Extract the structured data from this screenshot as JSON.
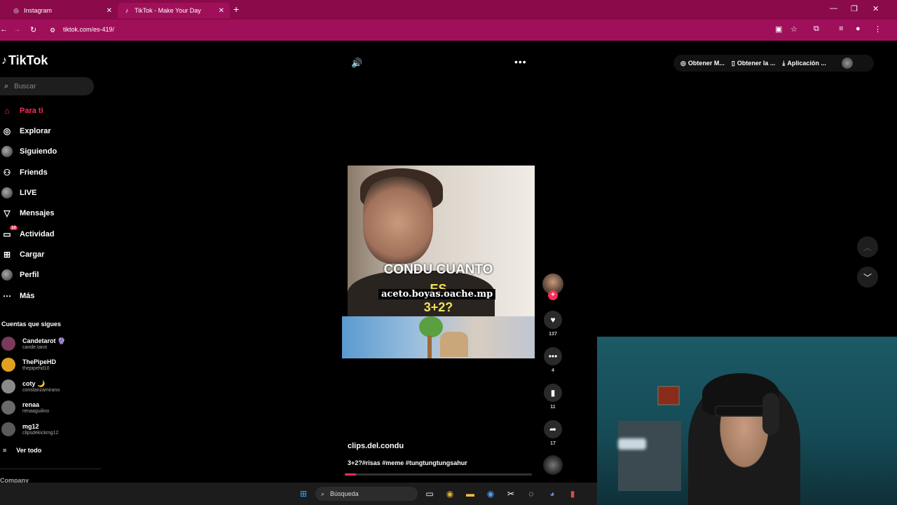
{
  "browser": {
    "tabs": [
      {
        "label": "Instagram",
        "icon": "instagram-icon"
      },
      {
        "label": "TikTok - Make Your Day",
        "icon": "tiktok-icon"
      }
    ],
    "url": "tiktok.com/es-419/"
  },
  "tiktok": {
    "logo_text": "TikTok",
    "search_placeholder": "Buscar",
    "nav": [
      {
        "label": "Para ti",
        "icon": "home-icon",
        "active": true
      },
      {
        "label": "Explorar",
        "icon": "compass-icon"
      },
      {
        "label": "Siguiendo",
        "icon": "following-icon"
      },
      {
        "label": "Friends",
        "icon": "friends-icon"
      },
      {
        "label": "LIVE",
        "icon": "live-icon"
      },
      {
        "label": "Mensajes",
        "icon": "messages-icon"
      },
      {
        "label": "Actividad",
        "icon": "activity-icon",
        "badge": "10"
      },
      {
        "label": "Cargar",
        "icon": "upload-icon"
      },
      {
        "label": "Perfil",
        "icon": "profile-icon"
      },
      {
        "label": "Más",
        "icon": "more-icon"
      }
    ],
    "following_header": "Cuentas que sigues",
    "following": [
      {
        "name": "Candetarot 🔮",
        "handle": "cande.tarot",
        "color": "#7a3a5a"
      },
      {
        "name": "ThePipeHD",
        "handle": "thepipehd10",
        "color": "#e0a020"
      },
      {
        "name": "coty 🌙",
        "handle": "constanzamirano",
        "color": "#8a8a8a"
      },
      {
        "name": "renaa",
        "handle": "renaaguilino",
        "color": "#6a6a6a"
      },
      {
        "name": "mg12",
        "handle": "clipsdekickmg12",
        "color": "#5a5a5a"
      }
    ],
    "see_all": "Ver todo",
    "company": "Company",
    "top_right": [
      {
        "label": "Obtener M...",
        "icon": "coin-icon"
      },
      {
        "label": "Obtener la ...",
        "icon": "phone-icon"
      },
      {
        "label": "Aplicación ...",
        "icon": "download-icon"
      }
    ],
    "video": {
      "caption_line1": "CONDU CUANTO",
      "caption_line2": "ES",
      "caption_line3": "3+2?",
      "watermark": "aceto.boyas.oache.mp",
      "progress": 0.06
    },
    "actions": {
      "likes": "137",
      "comments": "4",
      "saves": "11",
      "shares": "17"
    },
    "author": "clips.del.condu",
    "description": "3+2?#risas #meme #tungtungtungsahur"
  },
  "taskbar": {
    "search_label": "Búsqueda"
  },
  "colors": {
    "accent": "#fe2c55",
    "browser_chrome": "#8a0a4a"
  }
}
